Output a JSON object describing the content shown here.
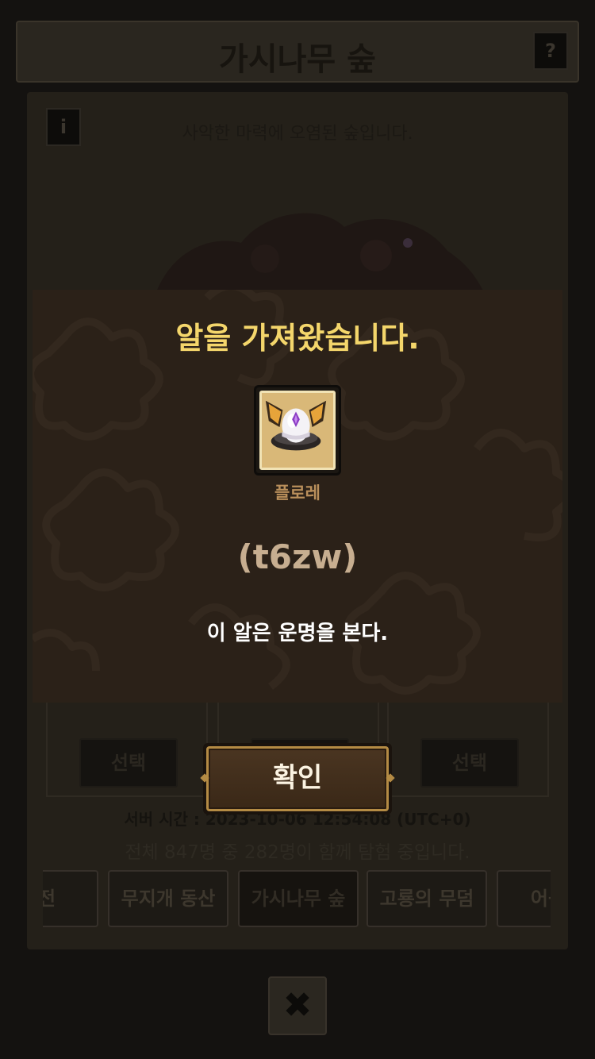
{
  "background": {
    "title": "가시나무 숲",
    "help_label": "?",
    "info_label": "i",
    "description": "사악한 마력에 오염된 숲입니다.",
    "slots": [
      {
        "button": "선택"
      },
      {
        "button": ""
      },
      {
        "button": "선택"
      }
    ],
    "server_time": "서버 시간 : 2023-10-06 12:54:08 (UTC+0)",
    "participants": "전체 847명 중 282명이 함께 탐험 중입니다.",
    "stage_tabs": [
      {
        "label": "신전",
        "active": false
      },
      {
        "label": "무지개 동산",
        "active": false
      },
      {
        "label": "가시나무 숲",
        "active": true
      },
      {
        "label": "고룡의 무덤",
        "active": false
      },
      {
        "label": "어둠의",
        "active": false
      }
    ],
    "close_label": "✖"
  },
  "modal": {
    "title": "알을 가져왔습니다.",
    "egg_name": "플로레",
    "egg_code": "(t6zw)",
    "egg_description": "이 알은 운명을 본다.",
    "confirm_label": "확인"
  },
  "colors": {
    "title_gold": "#f4d66b",
    "modal_bg": "#2b2118",
    "button_border": "#b48b44"
  }
}
